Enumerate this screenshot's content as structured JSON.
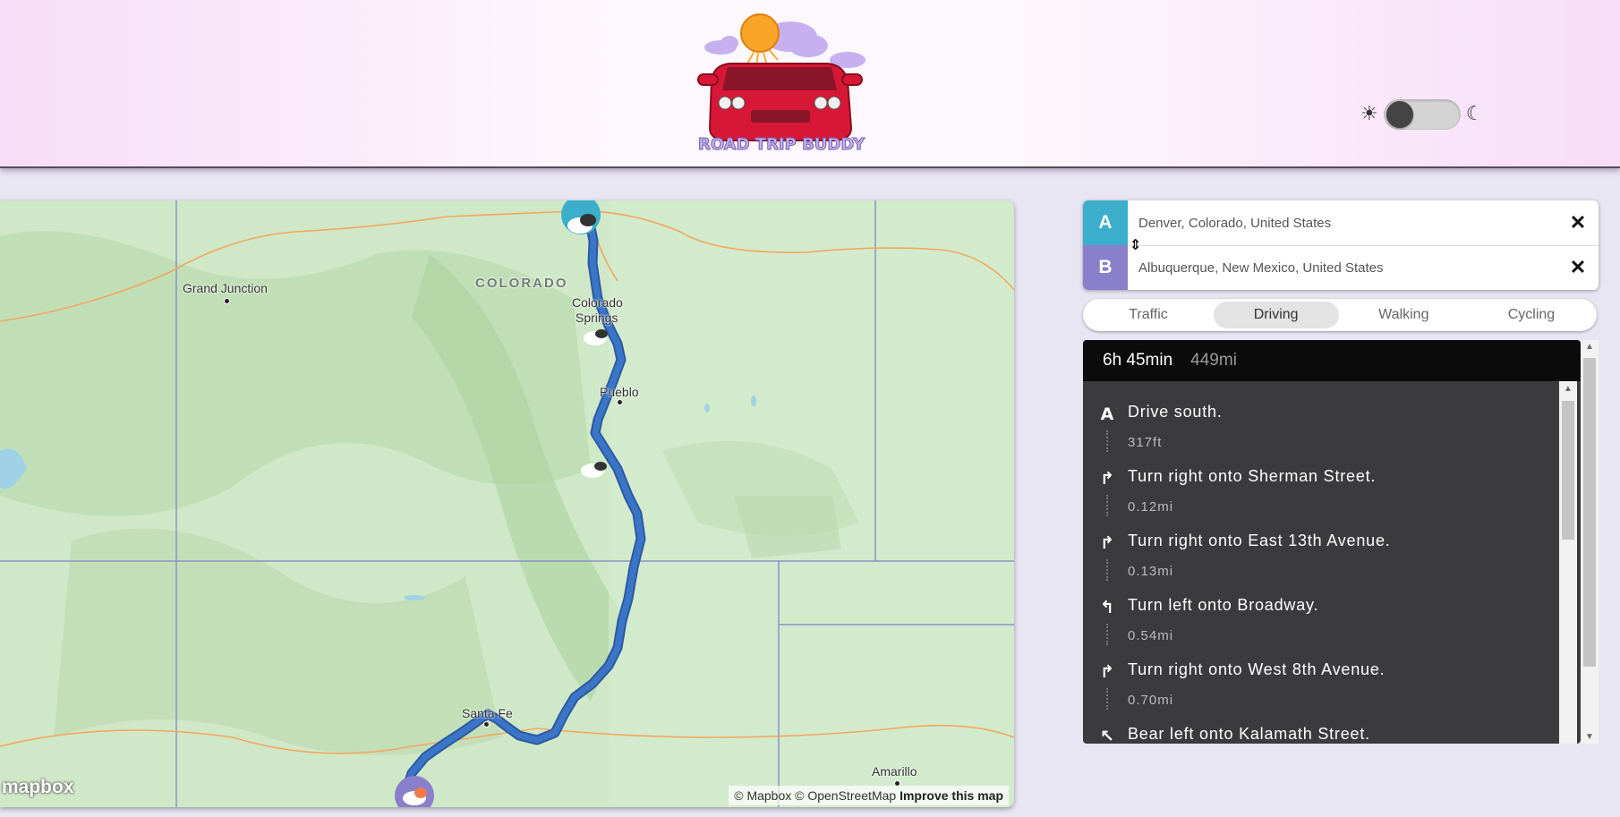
{
  "header": {
    "logo_text": "ROAD TRIP BUDDY",
    "theme": {
      "sun_icon": "☀",
      "moon_icon": "☾",
      "dark_mode": false
    }
  },
  "map": {
    "state_label": "COLORADO",
    "cities": [
      "Grand Junction",
      "Colorado Springs",
      "Pueblo",
      "Santa Fe",
      "Amarillo"
    ],
    "colorado_springs_line1": "Colorado",
    "colorado_springs_line2": "Springs",
    "mapbox_logo": "mapbox",
    "attribution_text": "© Mapbox © OpenStreetMap",
    "attribution_link": "Improve this map",
    "route_color": "#3b6fc0",
    "origin_marker_color": "#3aaecb",
    "destination_marker_color": "#8a7fcb"
  },
  "route": {
    "origin": {
      "marker": "A",
      "value": "Denver, Colorado, United States"
    },
    "destination": {
      "marker": "B",
      "value": "Albuquerque, New Mexico, United States"
    },
    "clear_icon": "✕",
    "reverse_icon": "⇕"
  },
  "profiles": [
    {
      "label": "Traffic",
      "active": false
    },
    {
      "label": "Driving",
      "active": true
    },
    {
      "label": "Walking",
      "active": false
    },
    {
      "label": "Cycling",
      "active": false
    }
  ],
  "directions": {
    "duration": "6h 45min",
    "distance": "449mi",
    "steps": [
      {
        "icon": "A",
        "text": "Drive south.",
        "distance": "317ft"
      },
      {
        "icon": "↱",
        "text": "Turn right onto Sherman Street.",
        "distance": "0.12mi"
      },
      {
        "icon": "↱",
        "text": "Turn right onto East 13th Avenue.",
        "distance": "0.13mi"
      },
      {
        "icon": "↰",
        "text": "Turn left onto Broadway.",
        "distance": "0.54mi"
      },
      {
        "icon": "↱",
        "text": "Turn right onto West 8th Avenue.",
        "distance": "0.70mi"
      },
      {
        "icon": "↖",
        "text": "Bear left onto Kalamath Street.",
        "distance": ""
      }
    ]
  }
}
